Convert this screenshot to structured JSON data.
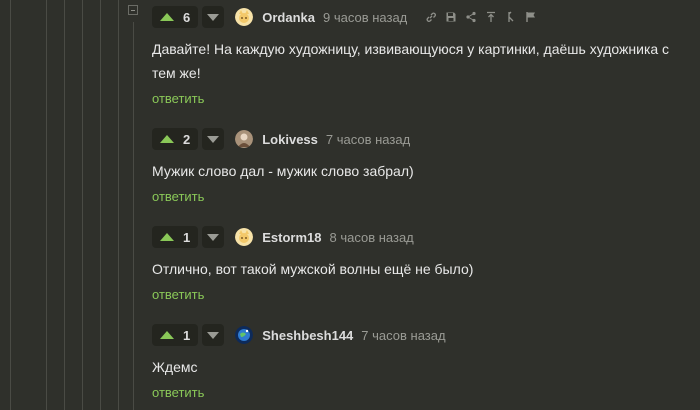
{
  "reply_label": "ответить",
  "colors": {
    "background": "#2f302b",
    "upvote": "#8ac858",
    "reply_link": "#8ac858",
    "thread_line": "#4a4b45"
  },
  "comments": [
    {
      "votes": "6",
      "avatar": "cat-avatar",
      "user": "Ordanka",
      "time": "9 часов назад",
      "text": "Давайте! На каждую художницу, извивающуюся у картинки, даёшь художника с тем же!",
      "tools": [
        "link-icon",
        "save-icon",
        "share-icon",
        "go-to-parent-icon",
        "branch-icon",
        "flag-icon"
      ]
    },
    {
      "votes": "2",
      "avatar": "photo-avatar",
      "user": "Lokivess",
      "time": "7 часов назад",
      "text": "Мужик слово дал - мужик слово забрал)"
    },
    {
      "votes": "1",
      "avatar": "cat-avatar",
      "user": "Estorm18",
      "time": "8 часов назад",
      "text": "Отлично, вот такой мужской волны ещё не было)"
    },
    {
      "votes": "1",
      "avatar": "planet-avatar",
      "user": "Sheshbesh144",
      "time": "7 часов назад",
      "text": "Ждемс"
    }
  ]
}
